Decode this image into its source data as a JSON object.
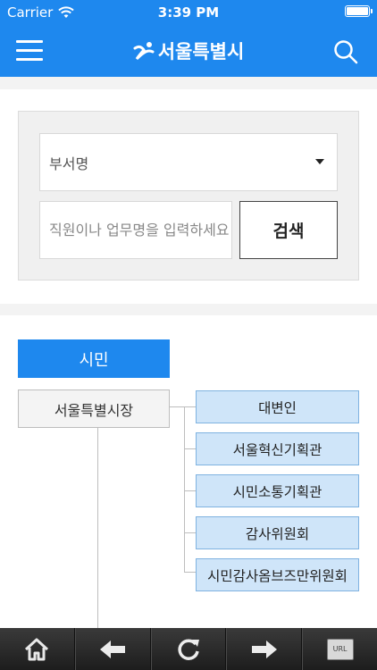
{
  "status_bar": {
    "carrier": "Carrier",
    "time": "3:39 PM"
  },
  "header": {
    "logo_text": "서울특별시",
    "menu_icon": "hamburger-menu-icon",
    "search_icon": "search-icon"
  },
  "search": {
    "department_select_value": "부서명",
    "query_placeholder": "직원이나 업무명을 입력하세요",
    "submit_label": "검색"
  },
  "org_chart": {
    "root_label": "시민",
    "head_label": "서울특별시장",
    "subunits": [
      "대변인",
      "서울혁신기획관",
      "시민소통기획관",
      "감사위원회",
      "시민감사옴브즈만위원회"
    ]
  },
  "toolbar": {
    "buttons": [
      "home-icon",
      "back-arrow-icon",
      "reload-icon",
      "forward-arrow-icon",
      "url-icon"
    ],
    "url_text": "URL"
  },
  "colors": {
    "brand_blue": "#1e88ee",
    "unit_fill": "#cfe5f9",
    "unit_border": "#7fb2e0",
    "toolbar_dark": "#2a2a2a"
  }
}
